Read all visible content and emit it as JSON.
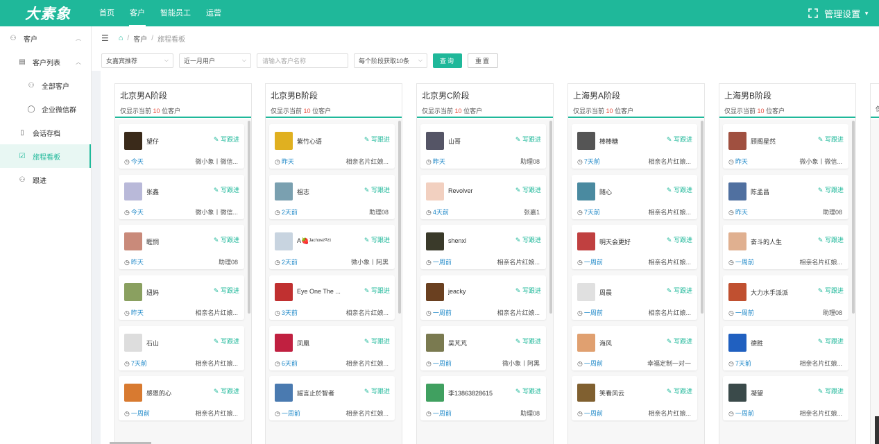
{
  "app": {
    "logo": "大素象",
    "admin_label": "管理设置"
  },
  "topnav": [
    "首页",
    "客户",
    "智能员工",
    "运营"
  ],
  "sidebar": {
    "items": [
      {
        "label": "客户",
        "icon": "user-icon"
      },
      {
        "label": "客户列表",
        "icon": "list-icon"
      },
      {
        "label": "全部客户",
        "icon": "users-icon"
      },
      {
        "label": "企业微信群",
        "icon": "chat-icon"
      },
      {
        "label": "会话存档",
        "icon": "archive-icon"
      },
      {
        "label": "旅程看板",
        "icon": "board-icon"
      },
      {
        "label": "跟进",
        "icon": "follow-icon"
      }
    ]
  },
  "breadcrumb": {
    "section": "客户",
    "current": "旅程看板"
  },
  "filters": {
    "select1": "女嘉宾推荐",
    "select2": "近一月用户",
    "search_placeholder": "请输入客户名称",
    "select3": "每个阶段获取10条",
    "query_btn": "查询",
    "reset_btn": "重置"
  },
  "board": {
    "follow_label": "写跟进",
    "sub_prefix": "仅显示当前",
    "sub_suffix": "位客户",
    "columns": [
      {
        "title": "北京男A阶段",
        "count": "10",
        "cards": [
          {
            "name": "望仔",
            "time": "今天",
            "tag": "微小象丨微信...",
            "color": "#3a2a1a"
          },
          {
            "name": "张鑫",
            "time": "今天",
            "tag": "微小象丨微信...",
            "color": "#b9b9d9"
          },
          {
            "name": "睚恫",
            "time": "昨天",
            "tag": "助理08",
            "color": "#c98a7a"
          },
          {
            "name": "妞妈",
            "time": "昨天",
            "tag": "相亲名片红娘...",
            "color": "#8aa060"
          },
          {
            "name": "石山",
            "time": "7天前",
            "tag": "相亲名片红娘...",
            "color": "#ddd"
          },
          {
            "name": "感恩的心",
            "time": "一周前",
            "tag": "相亲名片红娘...",
            "color": "#d87a30"
          }
        ]
      },
      {
        "title": "北京男B阶段",
        "count": "10",
        "cards": [
          {
            "name": "紫竹心语",
            "time": "昨天",
            "tag": "相亲名片红娘...",
            "color": "#e0b020"
          },
          {
            "name": "祖志",
            "time": "2天前",
            "tag": "助理08",
            "color": "#7aa0b0"
          },
          {
            "name": "A🍓ᴶᵃᶜʰᵒᶰ²⁰²¹",
            "time": "2天前",
            "tag": "微小象丨阿黑",
            "color": "#c8d4e0"
          },
          {
            "name": "Eye One The ...",
            "time": "3天前",
            "tag": "相亲名片红娘...",
            "color": "#c03030"
          },
          {
            "name": "凤凰",
            "time": "6天前",
            "tag": "相亲名片红娘...",
            "color": "#c02040"
          },
          {
            "name": "謡言止於智者",
            "time": "一周前",
            "tag": "相亲名片红娘...",
            "color": "#4a7ab0"
          }
        ]
      },
      {
        "title": "北京男C阶段",
        "count": "10",
        "cards": [
          {
            "name": "山哥",
            "time": "昨天",
            "tag": "助理08",
            "color": "#556"
          },
          {
            "name": "Revolver",
            "time": "4天前",
            "tag": "张嘉1",
            "color": "#f2d0c0"
          },
          {
            "name": "shenxl",
            "time": "一周前",
            "tag": "相亲名片红娘...",
            "color": "#3a3a2a"
          },
          {
            "name": "jeacky",
            "time": "一周前",
            "tag": "相亲名片红娘...",
            "color": "#6a4020"
          },
          {
            "name": "吴芃芃",
            "time": "一周前",
            "tag": "微小象丨阿黑",
            "color": "#7a7a50"
          },
          {
            "name": "李13863828615",
            "time": "一周前",
            "tag": "助理08",
            "color": "#40a060"
          }
        ]
      },
      {
        "title": "上海男A阶段",
        "count": "10",
        "cards": [
          {
            "name": "棒棒糖",
            "time": "7天前",
            "tag": "相亲名片红娘...",
            "color": "#555"
          },
          {
            "name": "随心",
            "time": "7天前",
            "tag": "相亲名片红娘...",
            "color": "#4a8aa0"
          },
          {
            "name": "明天会更好",
            "time": "一周前",
            "tag": "相亲名片红娘...",
            "color": "#c04040"
          },
          {
            "name": "周晨",
            "time": "一周前",
            "tag": "相亲名片红娘...",
            "color": "#e0e0e0"
          },
          {
            "name": "海风",
            "time": "一周前",
            "tag": "幸福定制一对一",
            "color": "#e0a070"
          },
          {
            "name": "笑看风云",
            "time": "一周前",
            "tag": "相亲名片红娘...",
            "color": "#806030"
          }
        ]
      },
      {
        "title": "上海男B阶段",
        "count": "10",
        "cards": [
          {
            "name": "顾阁星然",
            "time": "昨天",
            "tag": "微小象丨微信...",
            "color": "#a05040"
          },
          {
            "name": "陈孟昌",
            "time": "昨天",
            "tag": "助理08",
            "color": "#5070a0"
          },
          {
            "name": "奋斗的人生",
            "time": "一周前",
            "tag": "相亲名片红娘...",
            "color": "#e0b090"
          },
          {
            "name": "大力水手派派",
            "time": "一周前",
            "tag": "助理08",
            "color": "#c05030"
          },
          {
            "name": "德胜",
            "time": "7天前",
            "tag": "相亲名片红娘...",
            "color": "#2060c0"
          },
          {
            "name": "凝望",
            "time": "一周前",
            "tag": "相亲名片红娘...",
            "color": "#3a4a4a"
          }
        ]
      }
    ]
  },
  "partial_column_sub": "仅"
}
